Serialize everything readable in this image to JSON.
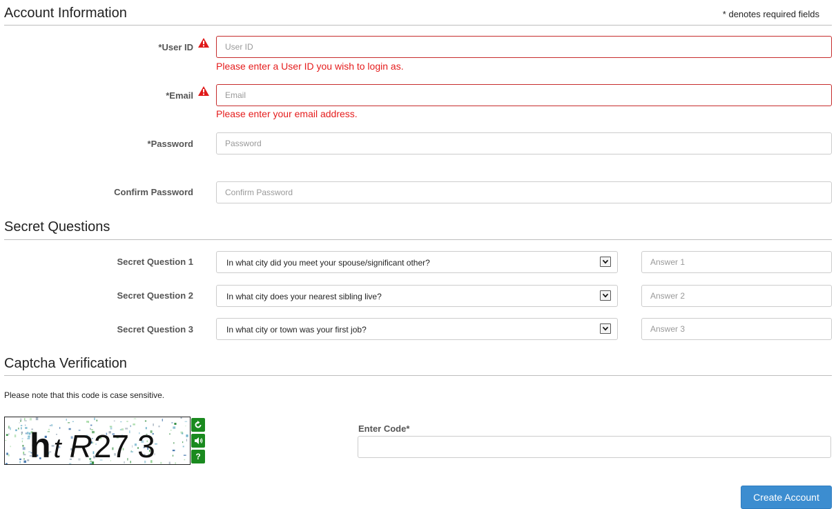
{
  "account": {
    "title": "Account Information",
    "required_note": "* denotes required fields",
    "user_id": {
      "label": "*User ID",
      "placeholder": "User ID",
      "error": "Please enter a User ID you wish to login as."
    },
    "email": {
      "label": "*Email",
      "placeholder": "Email",
      "error": "Please enter your email address."
    },
    "password": {
      "label": "*Password",
      "placeholder": "Password"
    },
    "confirm_password": {
      "label": "Confirm Password",
      "placeholder": "Confirm Password"
    }
  },
  "secret": {
    "title": "Secret Questions",
    "questions": [
      {
        "label": "Secret Question 1",
        "selected": "In what city did you meet your spouse/significant other?",
        "answer_placeholder": "Answer 1"
      },
      {
        "label": "Secret Question 2",
        "selected": "In what city does your nearest sibling live?",
        "answer_placeholder": "Answer 2"
      },
      {
        "label": "Secret Question 3",
        "selected": "In what city or town was your first job?",
        "answer_placeholder": "Answer 3"
      }
    ]
  },
  "captcha": {
    "title": "Captcha Verification",
    "note": "Please note that this code is case sensitive.",
    "code_text": "htR273",
    "buttons": {
      "refresh": "refresh-icon",
      "audio": "audio-icon",
      "help": "?"
    },
    "enter_label": "Enter Code*"
  },
  "submit_label": "Create Account",
  "colors": {
    "error": "#e51c1c",
    "primary": "#3c8dd0",
    "captcha_button": "#1a8a1f"
  }
}
